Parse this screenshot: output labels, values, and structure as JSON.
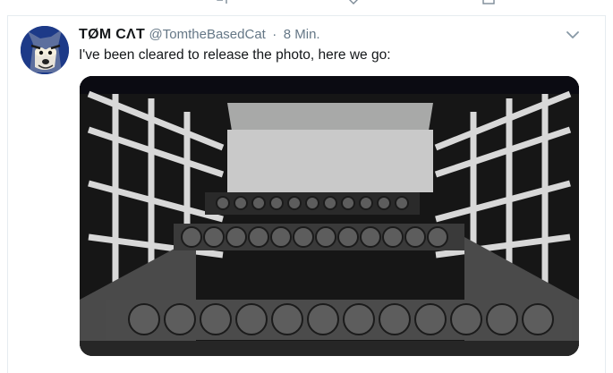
{
  "tweet": {
    "author_name": "TØM CΛT",
    "handle": "@TomtheBasedCat",
    "separator": "·",
    "time": "8 Min.",
    "text": "I've been cleared to release the photo, here we go:"
  },
  "colors": {
    "text_primary": "#14171a",
    "text_secondary": "#657786",
    "border": "#e6ecf0",
    "avatar_bg": "#1d3a88"
  },
  "icons": {
    "caret": "chevron-down-icon",
    "avatar": "avatar-image",
    "photo": "photo"
  }
}
